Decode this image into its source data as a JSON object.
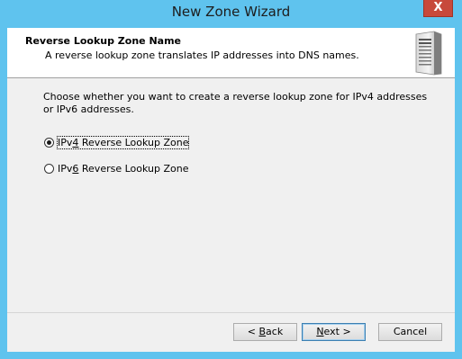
{
  "window": {
    "title": "New Zone Wizard",
    "close_glyph": "X"
  },
  "header": {
    "title": "Reverse Lookup Zone Name",
    "subtitle": "A reverse lookup zone translates IP addresses into DNS names.",
    "icon": "server-icon"
  },
  "content": {
    "instruction": "Choose whether you want to create a reverse lookup zone for IPv4 addresses or IPv6 addresses.",
    "options": [
      {
        "pre": "IPv",
        "accel": "4",
        "post": " Reverse Lookup Zone",
        "selected": true
      },
      {
        "pre": "IPv",
        "accel": "6",
        "post": " Reverse Lookup Zone",
        "selected": false
      }
    ]
  },
  "buttons": {
    "back": {
      "pre": "< ",
      "accel": "B",
      "post": "ack"
    },
    "next": {
      "pre": "",
      "accel": "N",
      "post": "ext >"
    },
    "cancel": {
      "label": "Cancel"
    }
  },
  "colors": {
    "title_bar": "#5fc3ee",
    "close_button": "#c7493b",
    "dialog_bg": "#f0f0f0"
  }
}
